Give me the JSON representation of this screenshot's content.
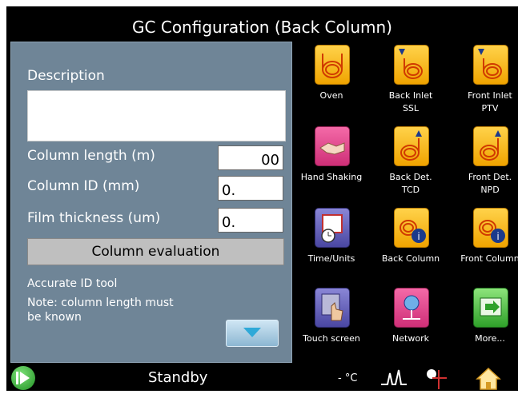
{
  "title": "GC Configuration  (Back Column)",
  "panel": {
    "description_label": "Description",
    "description_value": "",
    "column_length_label": "Column length (m)",
    "column_length_value": "00",
    "column_id_label": "Column ID (mm)",
    "column_id_value": "0.",
    "film_thickness_label": "Film thickness (um)",
    "film_thickness_value": "0.",
    "evaluation_button": "Column evaluation",
    "accurate_tool": "Accurate ID tool",
    "note_line1": "Note: column length must",
    "note_line2": "be known"
  },
  "tiles": [
    {
      "label": "Oven",
      "sub": "",
      "icon": "oven-coil-icon",
      "color": "#f0a400"
    },
    {
      "label": "Back Inlet",
      "sub": "SSL",
      "icon": "back-inlet-icon",
      "color": "#f0a400"
    },
    {
      "label": "Front Inlet",
      "sub": "PTV",
      "icon": "front-inlet-icon",
      "color": "#f0a400"
    },
    {
      "label": "Hand Shaking",
      "sub": "",
      "icon": "handshake-icon",
      "color": "#cf2f78"
    },
    {
      "label": "Back Det.",
      "sub": "TCD",
      "icon": "back-detector-icon",
      "color": "#f0a400"
    },
    {
      "label": "Front Det.",
      "sub": "NPD",
      "icon": "front-detector-icon",
      "color": "#f0a400"
    },
    {
      "label": "Time/Units",
      "sub": "",
      "icon": "calendar-clock-icon",
      "color": "#4a47a2"
    },
    {
      "label": "Back Column",
      "sub": "",
      "icon": "back-column-info-icon",
      "color": "#f0a400"
    },
    {
      "label": "Front Column",
      "sub": "",
      "icon": "front-column-info-icon",
      "color": "#f0a400"
    },
    {
      "label": "Touch screen",
      "sub": "",
      "icon": "touch-hand-icon",
      "color": "#4a47a2"
    },
    {
      "label": "Network",
      "sub": "",
      "icon": "network-icon",
      "color": "#cf2f78"
    },
    {
      "label": "More...",
      "sub": "",
      "icon": "arrow-right-icon",
      "color": "#2fa12a"
    }
  ],
  "status": {
    "state": "Standby",
    "temperature": "- °C"
  }
}
